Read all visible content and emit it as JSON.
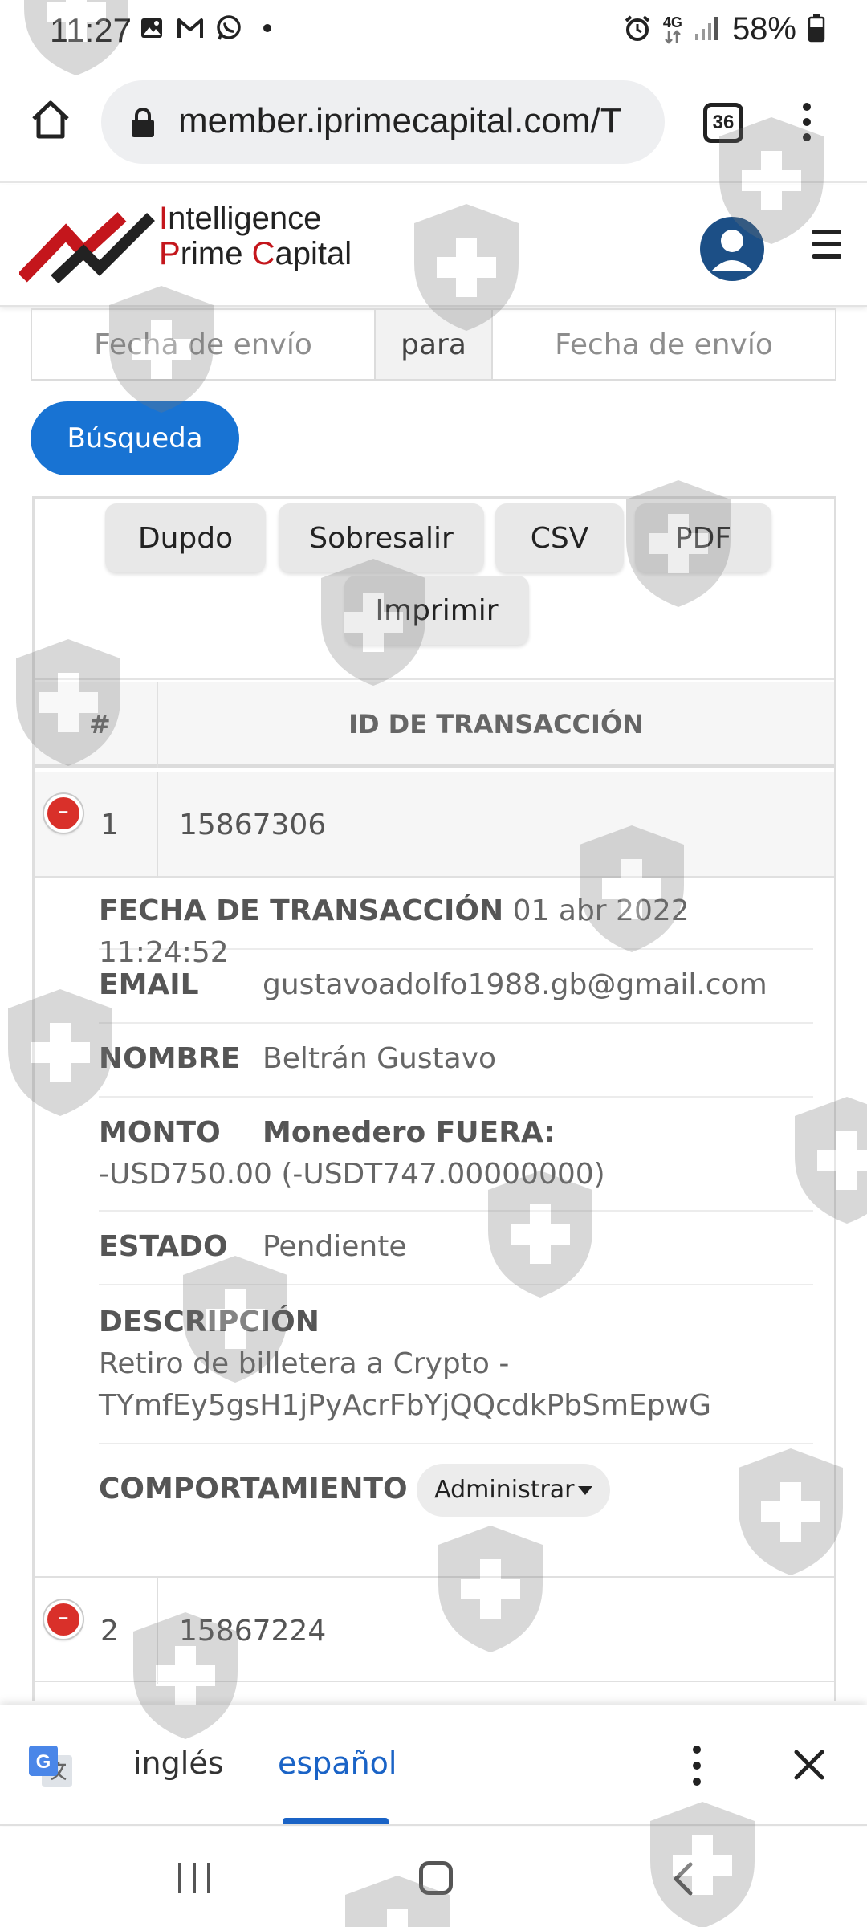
{
  "status_bar": {
    "time": "11:27",
    "battery": "58%",
    "network": "4G"
  },
  "browser": {
    "url": "member.iprimecapital.com/T",
    "tab_count": "36"
  },
  "site": {
    "logo_line1_first": "I",
    "logo_line1_rest": "ntelligence",
    "logo_line2_a": "P",
    "logo_line2_b": "rime ",
    "logo_line2_c": "C",
    "logo_line2_d": "apital"
  },
  "filter": {
    "from_placeholder": "Fecha de envío",
    "to_placeholder": "Fecha de envío",
    "connector": "para",
    "search_label": "Búsqueda"
  },
  "export_buttons": {
    "copy": "Dupdo",
    "excel": "Sobresalir",
    "csv": "CSV",
    "pdf": "PDF",
    "print": "Imprimir"
  },
  "table": {
    "headers": {
      "index": "#",
      "transaction_id": "ID DE TRANSACCIÓN"
    },
    "rows": [
      {
        "index": "1",
        "id": "15867306",
        "toggle": "–"
      },
      {
        "index": "2",
        "id": "15867224",
        "toggle": "–"
      }
    ]
  },
  "details": {
    "date_label": "FECHA DE TRANSACCIÓN",
    "date_value": "01 abr 2022 11:24:52",
    "email_label": "EMAIL",
    "email_value": "gustavoadolfo1988.gb@gmail.com",
    "name_label": "NOMBRE",
    "name_value": "Beltrán Gustavo",
    "amount_label": "MONTO",
    "wallet_label": "Monedero FUERA:",
    "amount_value": "-USD750.00 (-USDT747.00000000)",
    "status_label": "ESTADO",
    "status_value": "Pendiente",
    "description_label": "DESCRIPCIÓN",
    "description_line1": "Retiro de billetera a Crypto -",
    "description_line2": "TYmfEy5gsH1jPyAcrFbYjQQcdkPbSmEpwG",
    "behavior_label": "COMPORTAMIENTO",
    "admin_select": "Administrar"
  },
  "translate": {
    "lang_source": "inglés",
    "lang_target": "español"
  },
  "colors": {
    "primary_blue": "#1873d3",
    "brand_red": "#c4161c",
    "toggle_red": "#d9302a",
    "avatar_blue": "#1c4f86"
  }
}
